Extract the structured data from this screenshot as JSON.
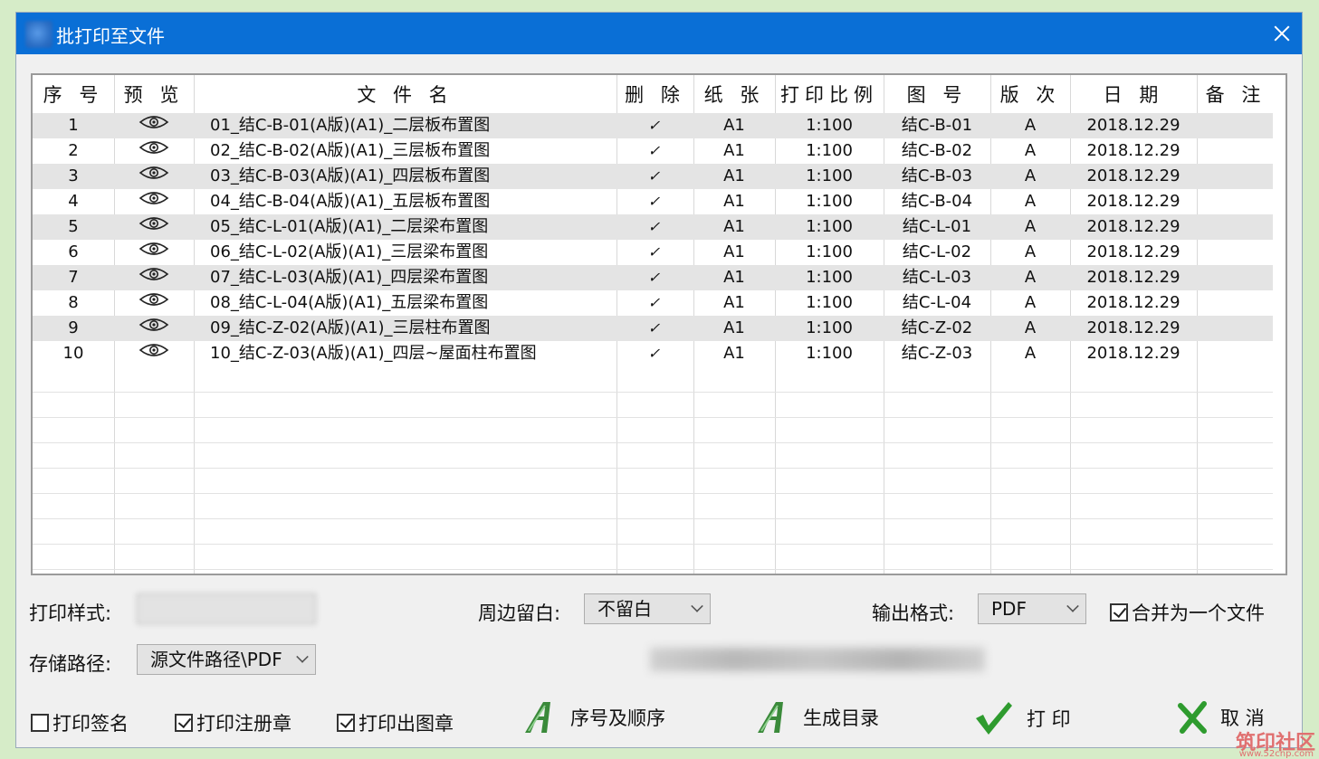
{
  "window": {
    "title": "批打印至文件"
  },
  "table": {
    "headers": [
      "序 号",
      "预 览",
      "文 件 名",
      "删 除",
      "纸 张",
      "打印比例",
      "图 号",
      "版 次",
      "日 期",
      "备 注"
    ],
    "rows": [
      [
        "1",
        "01_结C-B-01(A版)(A1)_二层板布置图",
        "A1",
        "1:100",
        "结C-B-01",
        "A",
        "2018.12.29",
        ""
      ],
      [
        "2",
        "02_结C-B-02(A版)(A1)_三层板布置图",
        "A1",
        "1:100",
        "结C-B-02",
        "A",
        "2018.12.29",
        ""
      ],
      [
        "3",
        "03_结C-B-03(A版)(A1)_四层板布置图",
        "A1",
        "1:100",
        "结C-B-03",
        "A",
        "2018.12.29",
        ""
      ],
      [
        "4",
        "04_结C-B-04(A版)(A1)_五层板布置图",
        "A1",
        "1:100",
        "结C-B-04",
        "A",
        "2018.12.29",
        ""
      ],
      [
        "5",
        "05_结C-L-01(A版)(A1)_二层梁布置图",
        "A1",
        "1:100",
        "结C-L-01",
        "A",
        "2018.12.29",
        ""
      ],
      [
        "6",
        "06_结C-L-02(A版)(A1)_三层梁布置图",
        "A1",
        "1:100",
        "结C-L-02",
        "A",
        "2018.12.29",
        ""
      ],
      [
        "7",
        "07_结C-L-03(A版)(A1)_四层梁布置图",
        "A1",
        "1:100",
        "结C-L-03",
        "A",
        "2018.12.29",
        ""
      ],
      [
        "8",
        "08_结C-L-04(A版)(A1)_五层梁布置图",
        "A1",
        "1:100",
        "结C-L-04",
        "A",
        "2018.12.29",
        ""
      ],
      [
        "9",
        "09_结C-Z-02(A版)(A1)_三层柱布置图",
        "A1",
        "1:100",
        "结C-Z-02",
        "A",
        "2018.12.29",
        ""
      ],
      [
        "10",
        "10_结C-Z-03(A版)(A1)_四层~屋面柱布置图",
        "A1",
        "1:100",
        "结C-Z-03",
        "A",
        "2018.12.29",
        ""
      ]
    ],
    "delete_glyph": "✓",
    "empty_rows": 8
  },
  "options": {
    "print_style_label": "打印样式:",
    "print_style_value": "",
    "margin_label": "周边留白:",
    "margin_value": "不留白",
    "output_format_label": "输出格式:",
    "output_format_value": "PDF",
    "merge_label": "合并为一个文件",
    "merge_checked": true,
    "save_path_label": "存储路径:",
    "save_path_value": "源文件路径\\PDF"
  },
  "footer": {
    "sign_label": "打印签名",
    "sign_checked": false,
    "reg_stamp_label": "打印注册章",
    "reg_stamp_checked": true,
    "out_stamp_label": "打印出图章",
    "out_stamp_checked": true,
    "order_btn": "序号及顺序",
    "catalog_btn": "生成目录",
    "print_btn": "打 印",
    "cancel_btn": "取 消"
  },
  "watermark": {
    "text": "筑印社区",
    "url": "www.52cnp.com"
  },
  "colors": {
    "titlebar": "#0a6fd6",
    "accent_green": "#2e7d32"
  }
}
